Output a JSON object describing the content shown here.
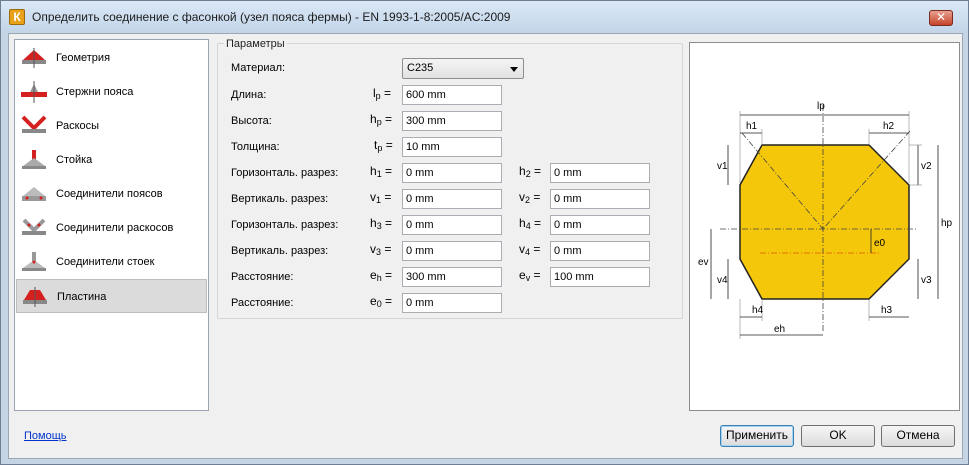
{
  "window": {
    "title": "Определить соединение с фасонкой (узел пояса фермы) - EN 1993-1-8:2005/AC:2009",
    "app_icon": "К",
    "close_glyph": "✕"
  },
  "sidebar": {
    "items": [
      {
        "label": "Геометрия",
        "icon": "geometry-icon"
      },
      {
        "label": "Стержни пояса",
        "icon": "chord-members-icon"
      },
      {
        "label": "Раскосы",
        "icon": "diagonals-icon"
      },
      {
        "label": "Стойка",
        "icon": "post-icon"
      },
      {
        "label": "Соединители поясов",
        "icon": "chord-connectors-icon"
      },
      {
        "label": "Соединители раскосов",
        "icon": "diagonal-connectors-icon"
      },
      {
        "label": "Соединители стоек",
        "icon": "post-connectors-icon"
      },
      {
        "label": "Пластина",
        "icon": "plate-icon",
        "selected": true
      }
    ]
  },
  "params": {
    "legend": "Параметры",
    "material": {
      "label": "Материал:",
      "value": "C235"
    },
    "length": {
      "label": "Длина:",
      "sym": "l",
      "sub": "p",
      "value": "600 mm"
    },
    "height": {
      "label": "Высота:",
      "sym": "h",
      "sub": "p",
      "value": "300 mm"
    },
    "thickness": {
      "label": "Толщина:",
      "sym": "t",
      "sub": "p",
      "value": "10 mm"
    },
    "hcut1": {
      "label": "Горизонталь. разрез:",
      "sym": "h",
      "sub": "1",
      "value": "0 mm",
      "sym2": "h",
      "sub2": "2",
      "value2": "0 mm"
    },
    "vcut1": {
      "label": "Вертикаль. разрез:",
      "sym": "v",
      "sub": "1",
      "value": "0 mm",
      "sym2": "v",
      "sub2": "2",
      "value2": "0 mm"
    },
    "hcut2": {
      "label": "Горизонталь. разрез:",
      "sym": "h",
      "sub": "3",
      "value": "0 mm",
      "sym2": "h",
      "sub2": "4",
      "value2": "0 mm"
    },
    "vcut2": {
      "label": "Вертикаль. разрез:",
      "sym": "v",
      "sub": "3",
      "value": "0 mm",
      "sym2": "v",
      "sub2": "4",
      "value2": "0 mm"
    },
    "dist1": {
      "label": "Расстояние:",
      "sym": "e",
      "sub": "h",
      "value": "300 mm",
      "sym2": "e",
      "sub2": "v",
      "value2": "100 mm"
    },
    "dist2": {
      "label": "Расстояние:",
      "sym": "e",
      "sub": "0",
      "value": "0 mm"
    },
    "eq": "="
  },
  "drawing": {
    "labels": {
      "lp": "lp",
      "h1": "h1",
      "h2": "h2",
      "v1": "v1",
      "v2": "v2",
      "hp": "hp",
      "ev": "ev",
      "v4": "v4",
      "v3": "v3",
      "h4": "h4",
      "h3": "h3",
      "eh": "eh",
      "e0": "e0"
    },
    "plate_color": "#f2c200"
  },
  "footer": {
    "help": "Помощь",
    "apply": "Применить",
    "ok": "OK",
    "cancel": "Отмена"
  }
}
